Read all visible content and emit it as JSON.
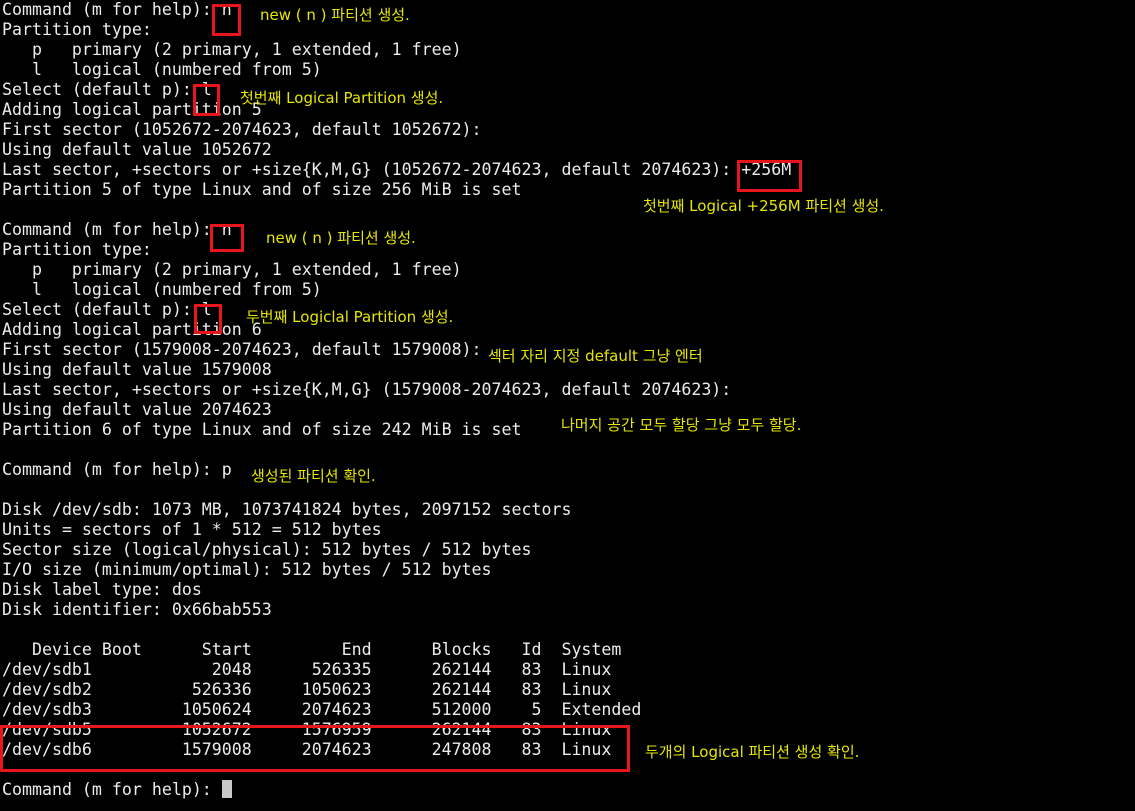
{
  "terminal": {
    "lines": [
      "Command (m for help): n",
      "Partition type:",
      "   p   primary (2 primary, 1 extended, 1 free)",
      "   l   logical (numbered from 5)",
      "Select (default p): l",
      "Adding logical partition 5",
      "First sector (1052672-2074623, default 1052672):",
      "Using default value 1052672",
      "Last sector, +sectors or +size{K,M,G} (1052672-2074623, default 2074623): +256M",
      "Partition 5 of type Linux and of size 256 MiB is set",
      "",
      "Command (m for help): n",
      "Partition type:",
      "   p   primary (2 primary, 1 extended, 1 free)",
      "   l   logical (numbered from 5)",
      "Select (default p): l",
      "Adding logical partition 6",
      "First sector (1579008-2074623, default 1579008):",
      "Using default value 1579008",
      "Last sector, +sectors or +size{K,M,G} (1579008-2074623, default 2074623):",
      "Using default value 2074623",
      "Partition 6 of type Linux and of size 242 MiB is set",
      "",
      "Command (m for help): p",
      "",
      "Disk /dev/sdb: 1073 MB, 1073741824 bytes, 2097152 sectors",
      "Units = sectors of 1 * 512 = 512 bytes",
      "Sector size (logical/physical): 512 bytes / 512 bytes",
      "I/O size (minimum/optimal): 512 bytes / 512 bytes",
      "Disk label type: dos",
      "Disk identifier: 0x66bab553",
      "",
      "   Device Boot      Start         End      Blocks   Id  System",
      "/dev/sdb1            2048      526335      262144   83  Linux",
      "/dev/sdb2          526336     1050623      262144   83  Linux",
      "/dev/sdb3         1050624     2074623      512000    5  Extended",
      "/dev/sdb5         1052672     1576959      262144   83  Linux",
      "/dev/sdb6         1579008     2074623      247808   83  Linux",
      "",
      "Command (m for help): "
    ]
  },
  "annotations": {
    "a1": "new ( n ) 파티션 생성.",
    "a2": "첫번째 Logical Partition 생성.",
    "a3": "첫번째 Logical +256M 파티션 생성.",
    "a4": "new ( n ) 파티션 생성.",
    "a5": "두번째 Logiclal Partition 생성.",
    "a6": "섹터 자리 지정 default 그냥 엔터",
    "a7": "나머지 공간 모두 할당 그냥 모두 할당.",
    "a8": "생성된 파티션 확인.",
    "a9": "두개의 Logical 파티션 생성 확인."
  },
  "colors": {
    "background": "#000000",
    "text": "#ececec",
    "annotation": "#e6e600",
    "highlight_box": "#e8161b"
  }
}
